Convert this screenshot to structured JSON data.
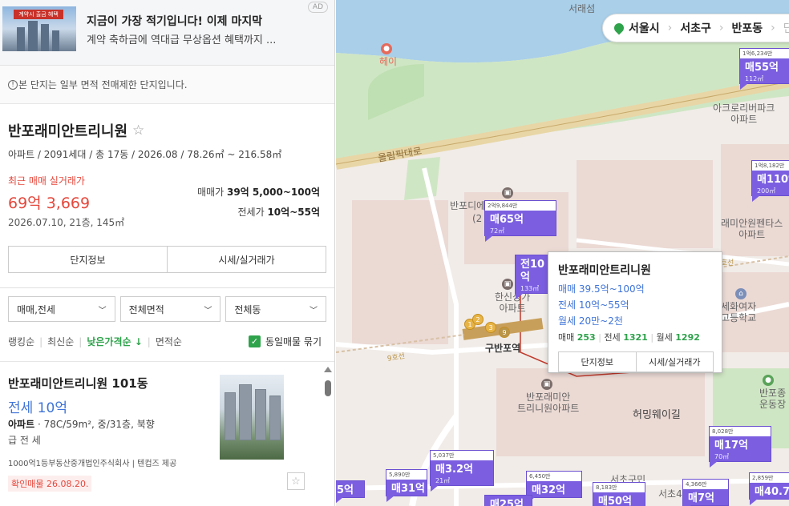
{
  "ad": {
    "banner_text": "계약시 출금 혜택",
    "title": "지금이 가장 적기입니다! 이제 마지막",
    "desc": "계약 축하금에 역대급 무상옵션 혜택까지 ...",
    "badge": "AD"
  },
  "notice": {
    "text": "본 단지는 일부 면적 전매제한 단지입니다."
  },
  "complex": {
    "name": "반포래미안트리니원",
    "meta": "아파트 / 2091세대 / 총 17동 / 2026.08 / 78.26㎡ ~ 216.58㎡",
    "recent_label": "최근 매매 실거래가",
    "recent_price": "69억 3,669",
    "recent_date": "2026.07.10, 21층, 145㎡",
    "sale_range_label": "매매가",
    "sale_range": "39억 5,000~100억",
    "jeonse_range_label": "전세가",
    "jeonse_range": "10억~55억",
    "btn_info": "단지정보",
    "btn_price": "시세/실거래가"
  },
  "filters": {
    "deal": "매매,전세",
    "area": "전체면적",
    "dong": "전체동"
  },
  "sort": {
    "ranking": "랭킹순",
    "newest": "최신순",
    "lowest": "낮은가격순",
    "lowest_arrow": "↓",
    "area": "면적순",
    "group_label": "동일매물 묶기"
  },
  "listing": {
    "title": "반포래미안트리니원 101동",
    "price": "전세 10억",
    "type_label": "아파트",
    "type_detail": "· 78C/59m², 중/31층, 북향",
    "features": "급 전 세",
    "agent": "1000억1등부동산중개법인주식회사 | 텐컵즈 제공",
    "confirm": "확인매물 26.08.20."
  },
  "breadcrumb": {
    "city": "서울시",
    "district": "서초구",
    "dong": "반포동",
    "next": "단"
  },
  "map_labels": {
    "top": "서래섬",
    "road": "올림픽대로",
    "hey": "헤이",
    "acro": "아크로리버파크\n아파트",
    "raemian_pentas": "래미안원펜타스\n아파트",
    "bandi": "반포디에",
    "bandi_sub": "(2",
    "hanshin": "한신상가\n아파트",
    "station": "구반포역",
    "complex": "반포래미안\n트리니원아파트",
    "heoming": "허밍웨이길",
    "sehwa": "세화여자\n고등학교",
    "banpo_field": "반포종\n운동장",
    "seocho_gu": "서초구민",
    "seocho4": "서초4",
    "line9": "9호선",
    "line9b": "9호선"
  },
  "markers": [
    {
      "header": "1억6,234만",
      "price": "매55억",
      "area": "112㎡"
    },
    {
      "header": "1억8,182만",
      "price": "매110억",
      "area": "200㎡"
    },
    {
      "header": "2억9,844만",
      "price": "매65억",
      "area": "72㎡"
    },
    {
      "header": "",
      "price": "전10억",
      "area": "133㎡"
    },
    {
      "header": "8,028만",
      "price": "매17억",
      "area": "70㎡"
    },
    {
      "header": "5,037만",
      "price": "매3.2억",
      "area": "21㎡"
    },
    {
      "header": "5,890만",
      "price": "매31억",
      "area": ""
    },
    {
      "header": "6,450만",
      "price": "매32억",
      "area": ""
    },
    {
      "header": "8,183만",
      "price": "매50억",
      "area": ""
    },
    {
      "header": "4,366만",
      "price": "매7억",
      "area": ""
    },
    {
      "header": "",
      "price": "5억",
      "area": ""
    },
    {
      "header": "",
      "price": "매25억",
      "area": ""
    },
    {
      "header": "2,859만",
      "price": "매40.7",
      "area": ""
    }
  ],
  "popup": {
    "title": "반포래미안트리니원",
    "sale": "매매 39.5억~100억",
    "jeonse": "전세 10억~55억",
    "monthly": "월세 20만~2천",
    "count_sale_label": "매매",
    "count_sale": "253",
    "count_jeonse_label": "전세",
    "count_jeonse": "1321",
    "count_monthly_label": "월세",
    "count_monthly": "1292",
    "btn_info": "단지정보",
    "btn_price": "시세/실거래가"
  },
  "colors": {
    "accent_green": "#2fa34c",
    "price_red": "#e5473b",
    "link_blue": "#3f74d8",
    "marker_purple": "#7b5fe0"
  }
}
